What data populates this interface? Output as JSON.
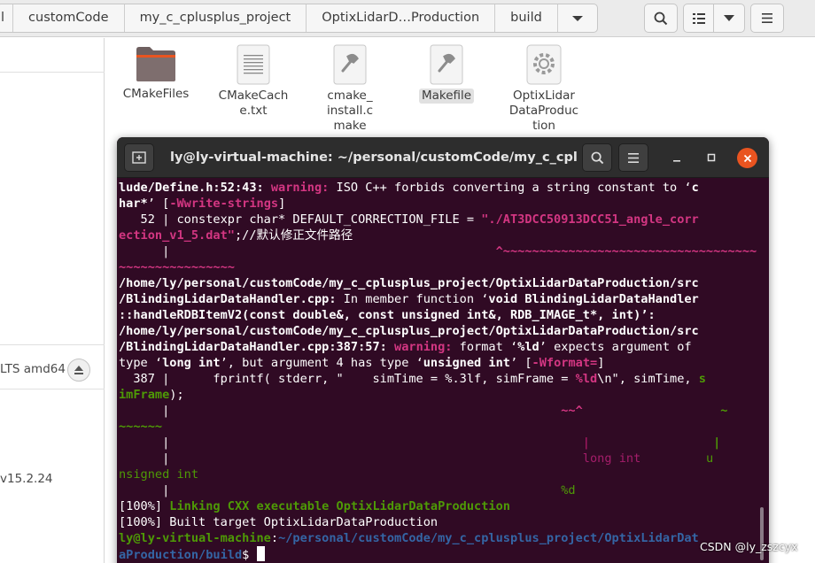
{
  "path_bar": {
    "segments": [
      "l",
      "customCode",
      "my_c_cplusplus_project",
      "OptixLidarD…Production",
      "build"
    ]
  },
  "toolbar": {
    "search_icon": "search-icon",
    "view_list_icon": "view-list-icon",
    "view_options_icon": "chevron-down-icon",
    "menu_icon": "hamburger-menu-icon"
  },
  "sidebar": {
    "device_label": "LTS amd64",
    "version_label": "v15.2.24"
  },
  "files": [
    {
      "name": "CMakeFiles",
      "icon": "folder-icon"
    },
    {
      "name": "CMakeCache.txt",
      "icon": "text-file-icon"
    },
    {
      "name": "cmake_install.cmake",
      "icon": "script-file-icon"
    },
    {
      "name": "Makefile",
      "icon": "script-file-icon"
    },
    {
      "name": "OptixLidarDataProduction",
      "icon": "executable-icon"
    }
  ],
  "terminal": {
    "title": "ly@ly-virtual-machine: ~/personal/customCode/my_c_cpluspl...",
    "lines": {
      "l01a": "lude/Define.h:52:43:",
      "l01b": "warning:",
      "l01c": "ISO C++ forbids converting a string constant to ‘",
      "l01d": "c",
      "l02a": "har*",
      "l02b": "’ [",
      "l02c": "-Wwrite-strings",
      "l02d": "]",
      "l03a": "   52 | constexpr char* DEFAULT_CORRECTION_FILE = ",
      "l03b": "\"./AT3DCC50913DCC51_angle_corr",
      "l04a": "ection_v1_5.dat\"",
      "l04b": ";//默认修正文件路径",
      "l05a": "      |                                             ",
      "l05b": "^~~~~~~~~~~~~~~~~~~~~~~~~~~~~~~~~~~~",
      "l06": "~~~~~~~~~~~~~~~~",
      "l07": "/home/ly/personal/customCode/my_c_cplusplus_project/OptixLidarDataProduction/src",
      "l08a": "/BlindingLidarDataHandler.cpp:",
      "l08b": " In member function ‘",
      "l08c": "void BlindingLidarDataHandler",
      "l09": "::handleRDBItemV2(const double&, const unsigned int&, RDB_IMAGE_t*, int)’:",
      "l10": "/home/ly/personal/customCode/my_c_cplusplus_project/OptixLidarDataProduction/src",
      "l11a": "/BlindingLidarDataHandler.cpp:387:57:",
      "l11b": "warning:",
      "l11c": " format ‘",
      "l11d": "%ld",
      "l11e": "’ expects argument of",
      "l12a": "type ‘",
      "l12b": "long int",
      "l12c": "’, but argument 4 has type ‘",
      "l12d": "unsigned int",
      "l12e": "’ [",
      "l12f": "-Wformat=",
      "l12g": "]",
      "l13a": "  387 |      fprintf( stderr, \"    simTime = %.3lf, simFrame = ",
      "l13b": "%ld",
      "l13c": "\\n\", simTime, ",
      "l13d": "s",
      "l14a": "imFrame",
      "l14b": ");",
      "l15a": "      |                                                      ",
      "l15b": "~~^",
      "l15c": "                   ~",
      "l16": "~~~~~~",
      "l17a": "      |                                                         ",
      "l17b": "|",
      "l17c": "                 |",
      "l18a": "      |                                                         ",
      "l18b": "long int",
      "l18c": "         u",
      "l19": "nsigned int",
      "l20a": "      |                                                      ",
      "l20b": "%d",
      "l21a": "[100%] ",
      "l21b": "Linking CXX executable OptixLidarDataProduction",
      "l22": "[100%] Built target OptixLidarDataProduction",
      "l23a": "ly@ly-virtual-machine",
      "l23b": ":",
      "l23c": "~/personal/customCode/my_c_cplusplus_project/OptixLidarDat",
      "l24a": "aProduction/build",
      "l24b": "$ "
    }
  },
  "watermark": "CSDN @ly_zszcyx"
}
